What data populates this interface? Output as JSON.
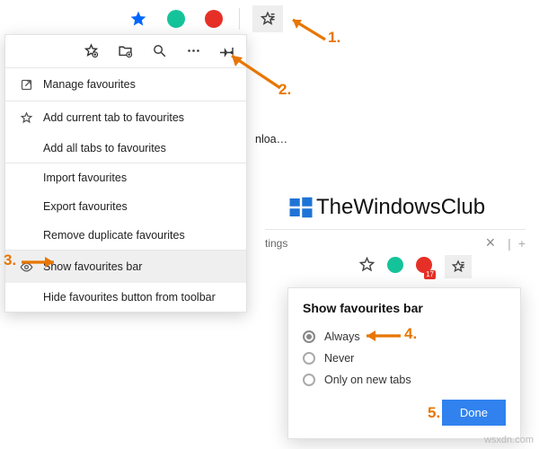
{
  "top_toolbar": {
    "favourites_button": "favourites"
  },
  "panel_toolbar": {
    "add_icon": "star",
    "collections_icon": "folder",
    "search_icon": "search",
    "more_icon": "more",
    "pin_icon": "pin"
  },
  "menu": {
    "manage": "Manage favourites",
    "add_current": "Add current tab to favourites",
    "add_all": "Add all tabs to favourites",
    "import": "Import favourites",
    "export": "Export favourites",
    "remove_dup": "Remove duplicate favourites",
    "show_bar": "Show favourites bar",
    "hide_btn": "Hide favourites button from toolbar"
  },
  "trunc_text": "nloa…",
  "brand": "TheWindowsClub",
  "toolbar2": {
    "text": "tings",
    "close": "×",
    "divider": "|",
    "plus": "+",
    "badge": "17"
  },
  "popup": {
    "title": "Show favourites bar",
    "options": [
      "Always",
      "Never",
      "Only on new tabs"
    ],
    "done": "Done"
  },
  "annotations": {
    "a1": "1.",
    "a2": "2.",
    "a3": "3.",
    "a4": "4.",
    "a5": "5."
  },
  "watermark": "wsxdn.com"
}
